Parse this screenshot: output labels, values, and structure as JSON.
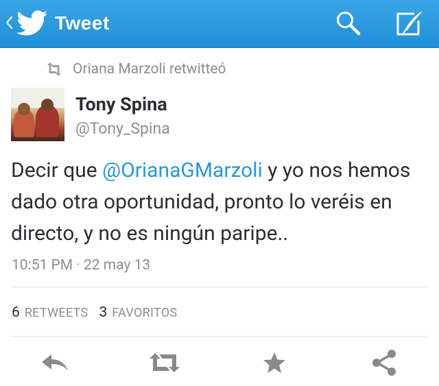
{
  "topbar": {
    "title": "Tweet",
    "icons": [
      "chevron-left-icon",
      "twitter-bird-icon",
      "search-icon",
      "compose-icon"
    ],
    "color": "#2a9be0"
  },
  "retweeted_by": {
    "text": "Oriana Marzoli retwitteó",
    "icon": "retweet-icon"
  },
  "tweet": {
    "author_name": "Tony Spina",
    "author_handle": "@Tony_Spina",
    "text_before": "Decir que ",
    "mention": "@OrianaGMarzoli",
    "text_after": " y yo nos hemos dado otra oportunidad, pronto lo veréis en directo, y no es ningún paripe..",
    "timestamp": "10:51 PM · 22 may 13",
    "mention_color": "#2b97d9"
  },
  "stats": {
    "retweets_count": "6",
    "retweets_label": "RETWEETS",
    "favorites_count": "3",
    "favorites_label": "FAVORITOS"
  },
  "actions": [
    "reply-icon",
    "retweet-icon",
    "favorite-star-icon",
    "share-icon"
  ]
}
